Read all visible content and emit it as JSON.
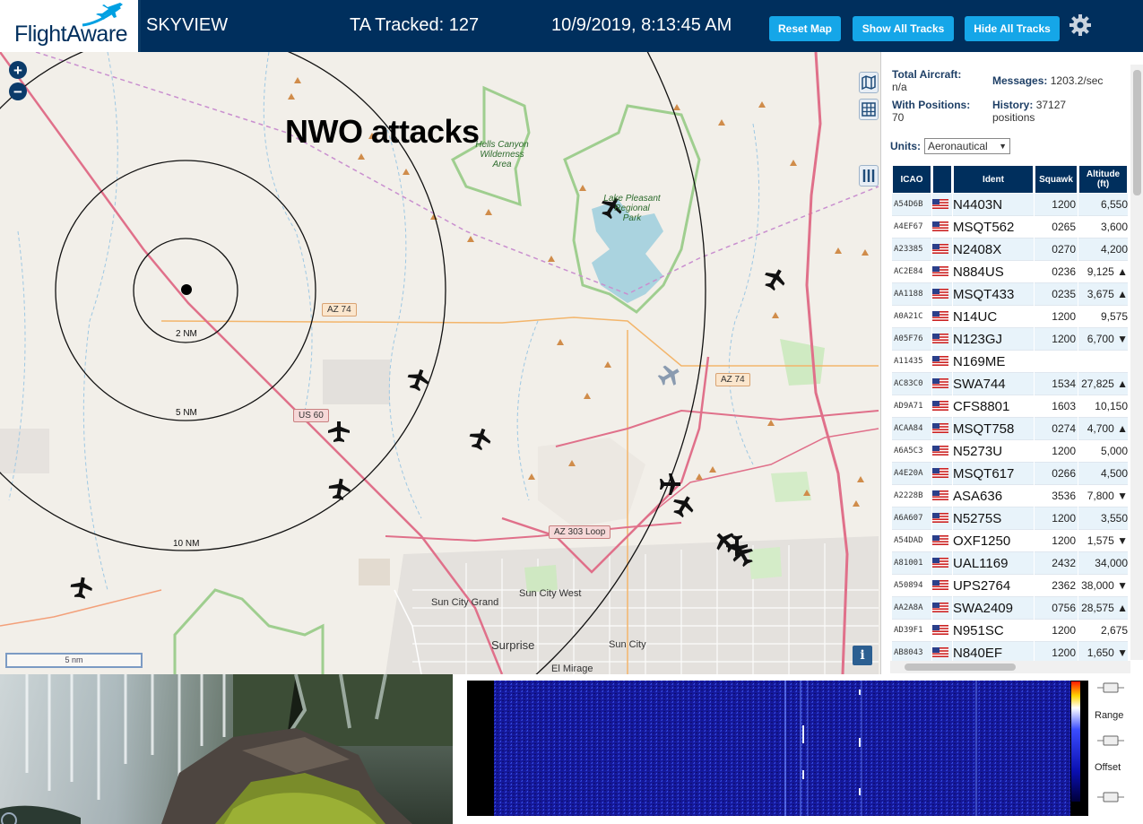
{
  "header": {
    "logo_text": "FlightAware",
    "app_title": "SKYVIEW",
    "tracked": "TA Tracked: 127",
    "datetime": "10/9/2019, 8:13:45 AM",
    "buttons": {
      "reset": "Reset Map",
      "show": "Show All Tracks",
      "hide": "Hide All Tracks"
    },
    "settings_icon": "gear-icon"
  },
  "map": {
    "overlay_text": "NWO attacks",
    "zoom_in": "+",
    "zoom_out": "−",
    "scale_label": "5 nm",
    "info_label": "i",
    "range_rings": [
      "2 NM",
      "5 NM",
      "10 NM"
    ],
    "roads": {
      "az74_a": "AZ 74",
      "az74_b": "AZ 74",
      "us60": "US 60",
      "az303": "AZ 303 Loop"
    },
    "park_labels": {
      "hells_canyon": "Hells Canyon\nWilderness\nArea",
      "lake_pleasant": "Lake Pleasant\nRegional\nPark"
    },
    "cities": {
      "sun_city_grand": "Sun City Grand",
      "sun_city_west": "Sun City West",
      "surprise": "Surprise",
      "sun_city": "Sun City",
      "el_mirage": "El Mirage"
    }
  },
  "panel": {
    "total_aircraft_label": "Total Aircraft:",
    "total_aircraft_value": "n/a",
    "with_positions_label": "With Positions:",
    "with_positions_value": "70",
    "messages_label": "Messages:",
    "messages_value": "1203.2/sec",
    "history_label": "History:",
    "history_value": "37127",
    "history_unit": "positions",
    "units_label": "Units:",
    "units_value": "Aeronautical",
    "columns": [
      "ICAO",
      "",
      "Ident",
      "Squawk",
      "Altitude (ft)"
    ],
    "rows": [
      {
        "icao": "A54D6B",
        "ident": "N4403N",
        "squawk": "1200",
        "alt": "6,550"
      },
      {
        "icao": "A4EF67",
        "ident": "MSQT562",
        "squawk": "0265",
        "alt": "3,600"
      },
      {
        "icao": "A23385",
        "ident": "N2408X",
        "squawk": "0270",
        "alt": "4,200"
      },
      {
        "icao": "AC2E84",
        "ident": "N884US",
        "squawk": "0236",
        "alt": "9,125 ▲"
      },
      {
        "icao": "AA1188",
        "ident": "MSQT433",
        "squawk": "0235",
        "alt": "3,675 ▲"
      },
      {
        "icao": "A0A21C",
        "ident": "N14UC",
        "squawk": "1200",
        "alt": "9,575"
      },
      {
        "icao": "A05F76",
        "ident": "N123GJ",
        "squawk": "1200",
        "alt": "6,700 ▼"
      },
      {
        "icao": "A11435",
        "ident": "N169ME",
        "squawk": "",
        "alt": ""
      },
      {
        "icao": "AC83C0",
        "ident": "SWA744",
        "squawk": "1534",
        "alt": "27,825 ▲"
      },
      {
        "icao": "AD9A71",
        "ident": "CFS8801",
        "squawk": "1603",
        "alt": "10,150"
      },
      {
        "icao": "ACAA84",
        "ident": "MSQT758",
        "squawk": "0274",
        "alt": "4,700 ▲"
      },
      {
        "icao": "A6A5C3",
        "ident": "N5273U",
        "squawk": "1200",
        "alt": "5,000"
      },
      {
        "icao": "A4E20A",
        "ident": "MSQT617",
        "squawk": "0266",
        "alt": "4,500"
      },
      {
        "icao": "A2228B",
        "ident": "ASA636",
        "squawk": "3536",
        "alt": "7,800 ▼"
      },
      {
        "icao": "A6A607",
        "ident": "N5275S",
        "squawk": "1200",
        "alt": "3,550"
      },
      {
        "icao": "A54DAD",
        "ident": "OXF1250",
        "squawk": "1200",
        "alt": "1,575 ▼"
      },
      {
        "icao": "A81001",
        "ident": "UAL1169",
        "squawk": "2432",
        "alt": "34,000"
      },
      {
        "icao": "A50894",
        "ident": "UPS2764",
        "squawk": "2362",
        "alt": "38,000 ▼"
      },
      {
        "icao": "AA2A8A",
        "ident": "SWA2409",
        "squawk": "0756",
        "alt": "28,575 ▲"
      },
      {
        "icao": "AD39F1",
        "ident": "N951SC",
        "squawk": "1200",
        "alt": "2,675"
      },
      {
        "icao": "AB8043",
        "ident": "N840EF",
        "squawk": "1200",
        "alt": "1,650 ▼"
      }
    ]
  },
  "spectrum": {
    "range_label": "Range",
    "offset_label": "Offset"
  },
  "colors": {
    "header_bg": "#002f5d",
    "button_bg": "#15a6e8",
    "table_header_bg": "#002f5d",
    "row_alt_bg": "#e8f3fa",
    "map_bg": "#f2efe9"
  }
}
